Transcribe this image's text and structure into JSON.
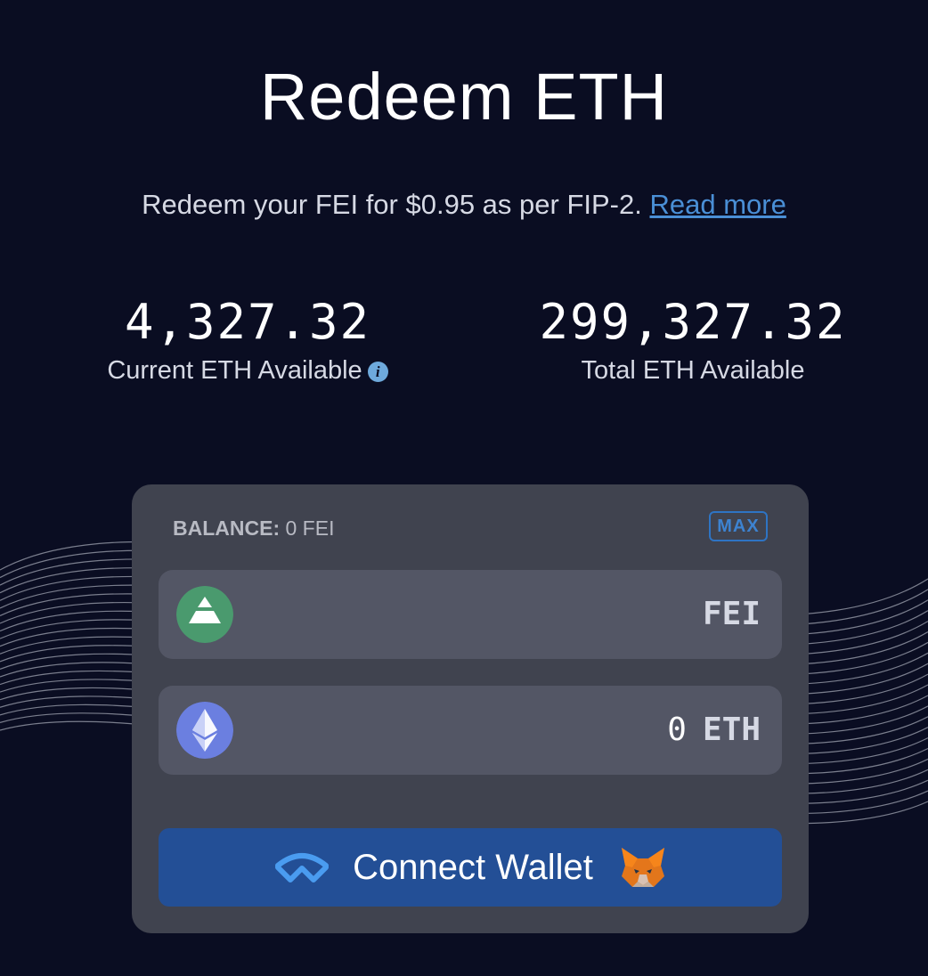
{
  "header": {
    "title": "Redeem ETH",
    "subtitle": "Redeem your FEI for $0.95 as per FIP-2.",
    "read_more": "Read more"
  },
  "stats": {
    "current": {
      "value": "4,327.32",
      "label": "Current ETH Available",
      "info_icon": "info-icon"
    },
    "total": {
      "value": "299,327.32",
      "label": "Total ETH Available"
    }
  },
  "card": {
    "balance_label": "BALANCE:",
    "balance_value": "0 FEI",
    "max_label": "MAX",
    "fei_field": {
      "amount": "",
      "unit": "FEI",
      "icon": "fei-token-icon"
    },
    "eth_field": {
      "amount": "0",
      "unit": "ETH",
      "icon": "eth-token-icon"
    },
    "connect_button": {
      "label": "Connect Wallet",
      "left_icon": "walletconnect-icon",
      "right_icon": "metamask-fox-icon"
    }
  },
  "colors": {
    "background": "#0a0d22",
    "card": "#40434f",
    "field": "#535665",
    "button": "#234f96",
    "link": "#4a8fd6",
    "fei_green": "#4a9a6e",
    "eth_purple": "#6b7fe0"
  }
}
